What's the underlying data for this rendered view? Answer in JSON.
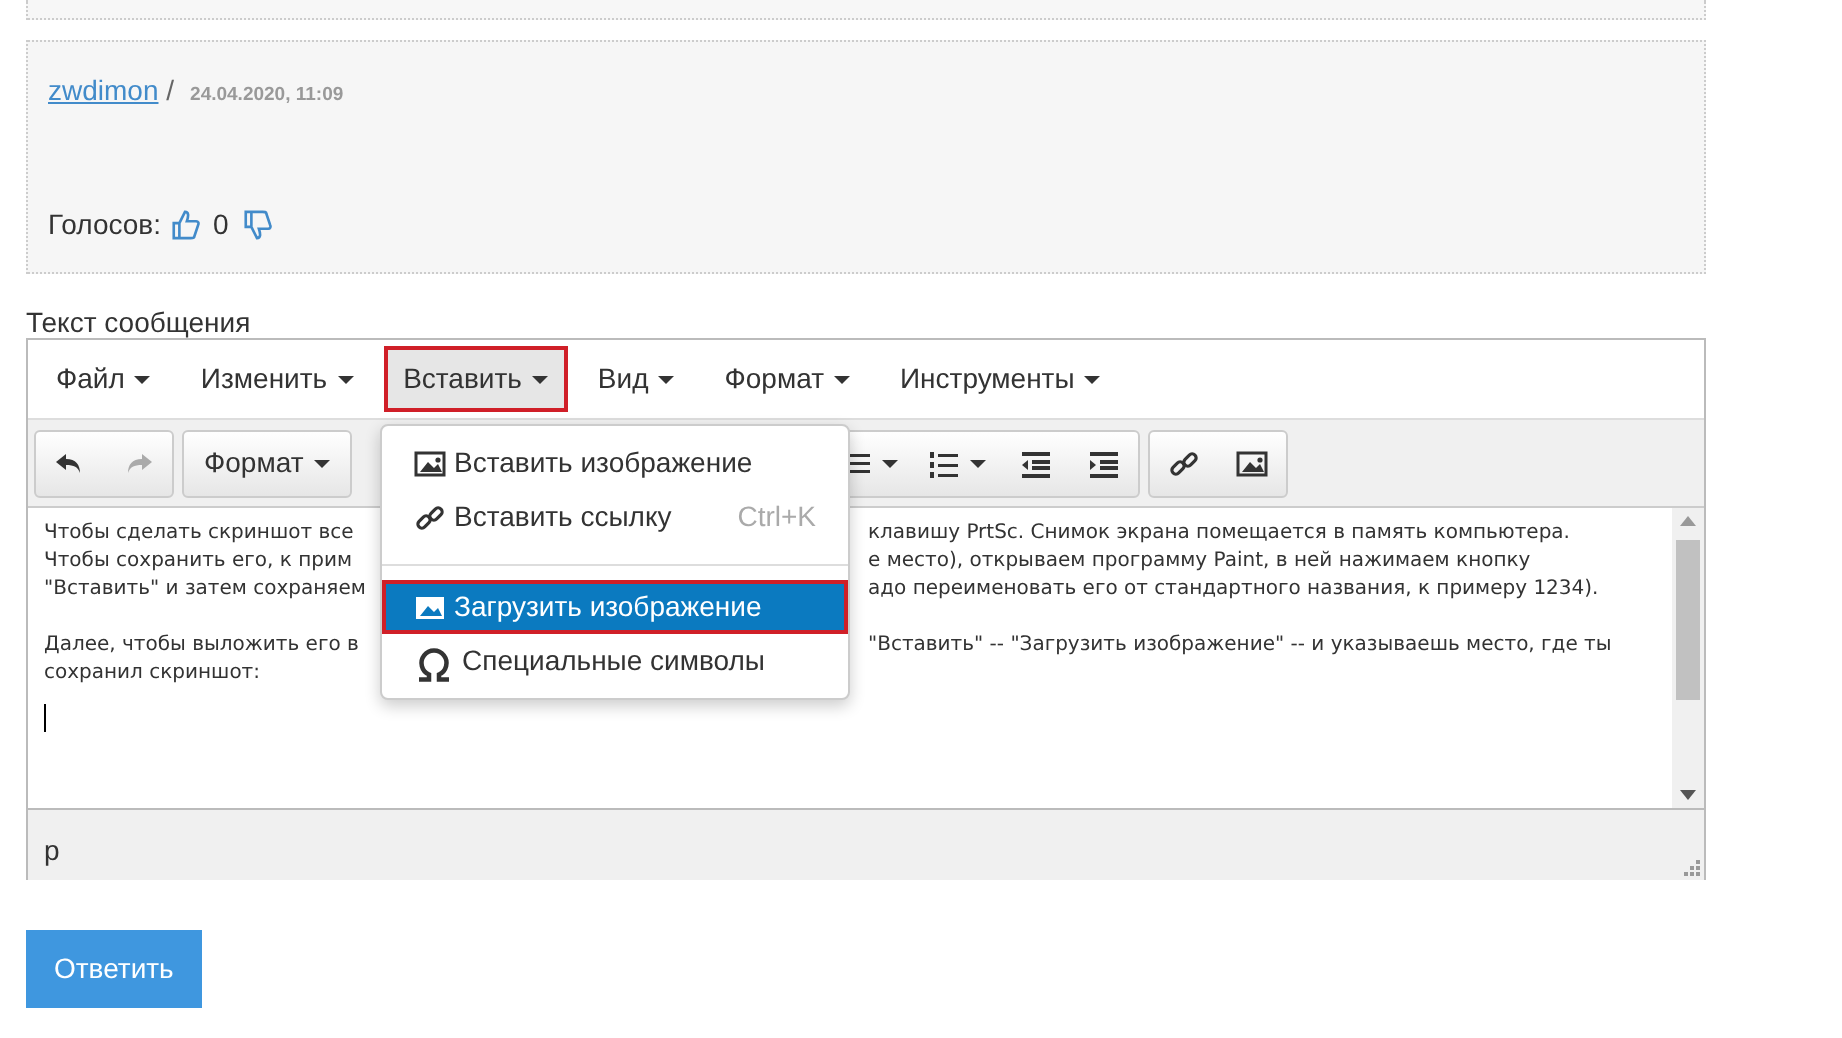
{
  "post": {
    "author": "zwdimon",
    "separator": "/",
    "date": "24.04.2020, 11:09",
    "votes_label": "Голосов:",
    "votes_count": "0"
  },
  "editor_label": "Текст сообщения",
  "menubar": [
    {
      "label": "Файл",
      "selected": false,
      "outlined": false
    },
    {
      "label": "Изменить",
      "selected": false,
      "outlined": false
    },
    {
      "label": "Вставить",
      "selected": true,
      "outlined": true
    },
    {
      "label": "Вид",
      "selected": false,
      "outlined": false
    },
    {
      "label": "Формат",
      "selected": false,
      "outlined": false
    },
    {
      "label": "Инструменты",
      "selected": false,
      "outlined": false
    }
  ],
  "toolbar_left": [
    {
      "kind": "undo"
    },
    {
      "kind": "redo"
    },
    {
      "kind": "select",
      "label": "Формат"
    }
  ],
  "toolbar_right": [
    {
      "kind": "bullets"
    },
    {
      "kind": "numbers"
    },
    {
      "kind": "outdent"
    },
    {
      "kind": "indent"
    },
    {
      "kind": "link"
    },
    {
      "kind": "image"
    }
  ],
  "dropdown": [
    {
      "kind": "image",
      "label": "Вставить изображение",
      "selected": false,
      "outlined": false
    },
    {
      "kind": "link",
      "label": "Вставить ссылку",
      "shortcut": "Ctrl+K",
      "selected": false,
      "outlined": false
    },
    {
      "kind": "separator"
    },
    {
      "kind": "image",
      "label": "Загрузить изображение",
      "selected": true,
      "outlined": true
    },
    {
      "kind": "symbols",
      "label": "Специальные символы",
      "selected": false,
      "outlined": false
    }
  ],
  "paragraphs": [
    [
      {
        "left": "Чтобы сделать скриншот все",
        "right": "клавишу PrtSc. Снимок экрана помещается в память компьютера."
      },
      {
        "left": "Чтобы сохранить его, к прим",
        "right": "е место), открываем программу Paint, в ней нажимаем кнопку"
      },
      {
        "left": "\"Вставить\" и затем сохраняем",
        "right": "адо переименовать его от стандартного названия, к примеру 1234)."
      }
    ],
    [
      {
        "left": "Далее, чтобы выложить его в",
        "right": "\"Вставить\" -- \"Загрузить изображение\" -- и указываешь место, где ты"
      },
      {
        "left": "сохранил скриншот:"
      }
    ]
  ],
  "status_path": "p",
  "reply_button": "Ответить"
}
